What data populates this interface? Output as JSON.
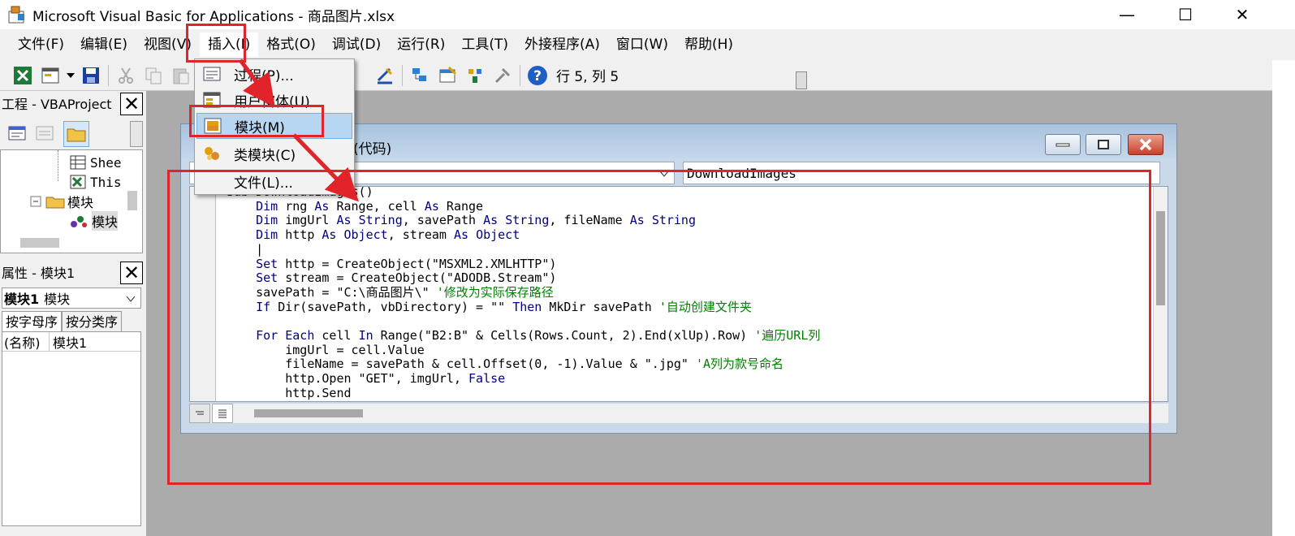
{
  "window": {
    "title": "Microsoft Visual Basic for Applications - 商品图片.xlsx",
    "minimize": "—",
    "maximize": "☐",
    "close": "✕"
  },
  "menu": [
    "文件(F)",
    "编辑(E)",
    "视图(V)",
    "插入(I)",
    "格式(O)",
    "调试(D)",
    "运行(R)",
    "工具(T)",
    "外接程序(A)",
    "窗口(W)",
    "帮助(H)"
  ],
  "toolbar": {
    "position": "行 5, 列 5"
  },
  "project_pane": {
    "title": "工程 - VBAProject",
    "tree": [
      "Shee",
      "This",
      "模块",
      "模块"
    ]
  },
  "properties_pane": {
    "title": "属性 - 模块1",
    "object_bold": "模块1",
    "object_type": "模块",
    "tabs": [
      "按字母序",
      "按分类序"
    ],
    "row_name": "(名称)",
    "row_value": "模块1"
  },
  "insert_menu": {
    "items": [
      "过程(P)...",
      "用户窗体(U)",
      "模块(M)",
      "类模块(C)",
      "文件(L)..."
    ]
  },
  "code_window": {
    "title_suffix": "(代码)",
    "proc_combo": "DownloadImages",
    "lines": [
      [
        {
          "t": "Sub DownloadImages()",
          "c": "kw0"
        }
      ],
      [
        {
          "t": "    "
        },
        {
          "t": "Dim",
          "c": "kw"
        },
        {
          "t": " rng "
        },
        {
          "t": "As",
          "c": "kw"
        },
        {
          "t": " Range, cell "
        },
        {
          "t": "As",
          "c": "kw"
        },
        {
          "t": " Range"
        }
      ],
      [
        {
          "t": "    "
        },
        {
          "t": "Dim",
          "c": "kw"
        },
        {
          "t": " imgUrl "
        },
        {
          "t": "As",
          "c": "kw"
        },
        {
          "t": " "
        },
        {
          "t": "String",
          "c": "kw"
        },
        {
          "t": ", savePath "
        },
        {
          "t": "As",
          "c": "kw"
        },
        {
          "t": " "
        },
        {
          "t": "String",
          "c": "kw"
        },
        {
          "t": ", fileName "
        },
        {
          "t": "As",
          "c": "kw"
        },
        {
          "t": " "
        },
        {
          "t": "String",
          "c": "kw"
        }
      ],
      [
        {
          "t": "    "
        },
        {
          "t": "Dim",
          "c": "kw"
        },
        {
          "t": " http "
        },
        {
          "t": "As",
          "c": "kw"
        },
        {
          "t": " "
        },
        {
          "t": "Object",
          "c": "kw"
        },
        {
          "t": ", stream "
        },
        {
          "t": "As",
          "c": "kw"
        },
        {
          "t": " "
        },
        {
          "t": "Object",
          "c": "kw"
        }
      ],
      [
        {
          "t": "    |"
        }
      ],
      [
        {
          "t": "    "
        },
        {
          "t": "Set",
          "c": "kw"
        },
        {
          "t": " http = CreateObject(\"MSXML2.XMLHTTP\")"
        }
      ],
      [
        {
          "t": "    "
        },
        {
          "t": "Set",
          "c": "kw"
        },
        {
          "t": " stream = CreateObject(\"ADODB.Stream\")"
        }
      ],
      [
        {
          "t": "    savePath = \"C:\\商品图片\\\" "
        },
        {
          "t": "'修改为实际保存路径",
          "c": "cm"
        }
      ],
      [
        {
          "t": "    "
        },
        {
          "t": "If",
          "c": "kw"
        },
        {
          "t": " Dir(savePath, vbDirectory) = \"\" "
        },
        {
          "t": "Then",
          "c": "kw"
        },
        {
          "t": " MkDir savePath "
        },
        {
          "t": "'自动创建文件夹",
          "c": "cm"
        }
      ],
      [
        {
          "t": ""
        }
      ],
      [
        {
          "t": "    "
        },
        {
          "t": "For Each",
          "c": "kw"
        },
        {
          "t": " cell "
        },
        {
          "t": "In",
          "c": "kw"
        },
        {
          "t": " Range(\"B2:B\" & Cells(Rows.Count, 2).End(xlUp).Row) "
        },
        {
          "t": "'遍历URL列",
          "c": "cm"
        }
      ],
      [
        {
          "t": "        imgUrl = cell.Value"
        }
      ],
      [
        {
          "t": "        fileName = savePath & cell.Offset(0, -1).Value & \".jpg\" "
        },
        {
          "t": "'A列为款号命名",
          "c": "cm"
        }
      ],
      [
        {
          "t": "        http.Open \"GET\", imgUrl, "
        },
        {
          "t": "False",
          "c": "kw"
        }
      ],
      [
        {
          "t": "        http.Send"
        }
      ]
    ]
  },
  "colors": {
    "annotation_red": "#e0242a",
    "keyword": "#00007f",
    "comment": "#007f00",
    "highlight": "#b7d6f2"
  }
}
